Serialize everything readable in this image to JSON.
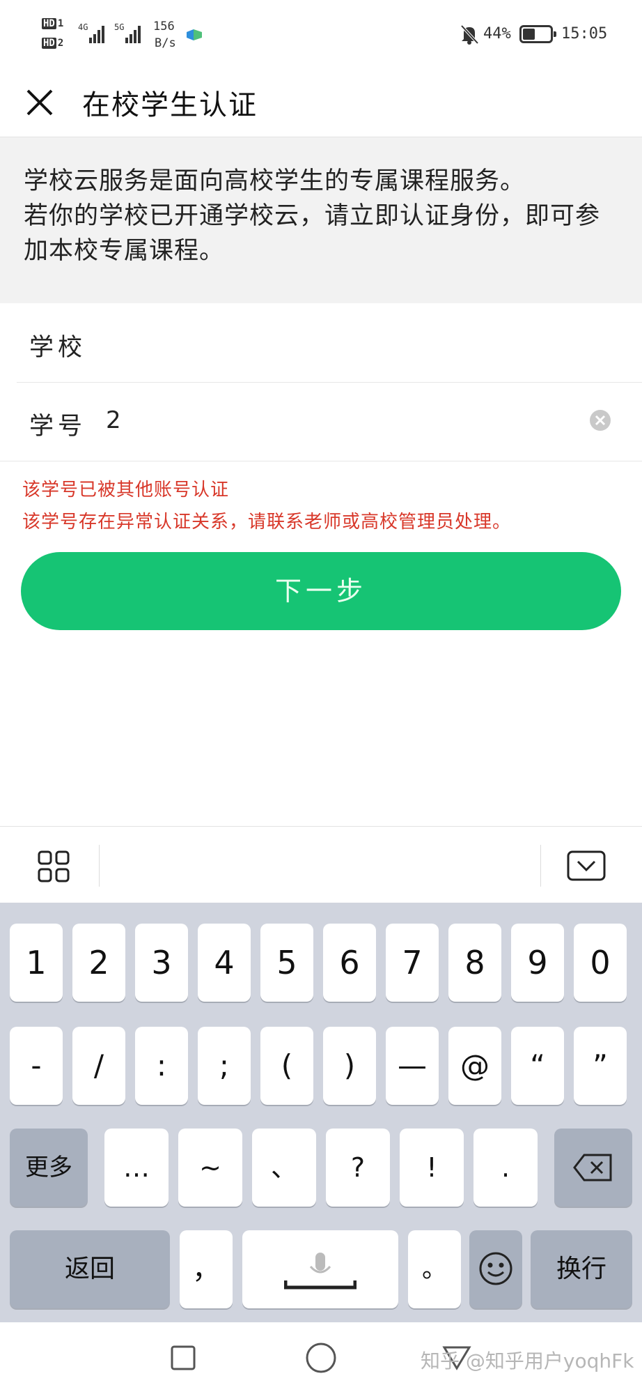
{
  "status_bar": {
    "hd1": "HD",
    "hd1_num": "1",
    "hd2": "HD",
    "hd2_num": "2",
    "net1": "4G",
    "net2": "5G",
    "speed_value": "156",
    "speed_unit": "B/s",
    "battery_percent": "44%",
    "battery_level": 0.44,
    "time": "15:05"
  },
  "header": {
    "close_icon": "close-icon",
    "title": "在校学生认证"
  },
  "intro": {
    "line1": "学校云服务是面向高校学生的专属课程服务。",
    "line2": "若你的学校已开通学校云，请立即认证身份，即可参加本校专属课程。"
  },
  "form": {
    "school_label": "学校",
    "school_value": "",
    "student_id_label": "学号",
    "student_id_value": "2",
    "clear_icon": "clear-icon"
  },
  "errors": {
    "line1": "该学号已被其他账号认证",
    "line2": "该学号存在异常认证关系，请联系老师或高校管理员处理。"
  },
  "next_button": "下一步",
  "colors": {
    "accent_green": "#16c474",
    "error_red": "#d8382a",
    "keyboard_bg": "#d0d4de"
  },
  "keyboard": {
    "toolbar_left_icon": "grid-icon",
    "toolbar_right_icon": "hide-keyboard-icon",
    "row_numbers": [
      "1",
      "2",
      "3",
      "4",
      "5",
      "6",
      "7",
      "8",
      "9",
      "0"
    ],
    "row_symbols": [
      "-",
      "/",
      ":",
      ";",
      "(",
      ")",
      "—",
      "@",
      "“",
      "”"
    ],
    "more_label": "更多",
    "row_punct": [
      "…",
      "~",
      "、",
      "?",
      "!",
      "."
    ],
    "backspace_icon": "backspace-icon",
    "back_label": "返回",
    "comma": "，",
    "mic_icon": "microphone-icon",
    "period": "。",
    "emoji_icon": "emoji-icon",
    "enter_label": "换行"
  },
  "nav_bar": {
    "recent_icon": "square-icon",
    "home_icon": "circle-icon",
    "back_icon": "triangle-icon",
    "watermark": "知乎 @知乎用户yoqhFk"
  }
}
